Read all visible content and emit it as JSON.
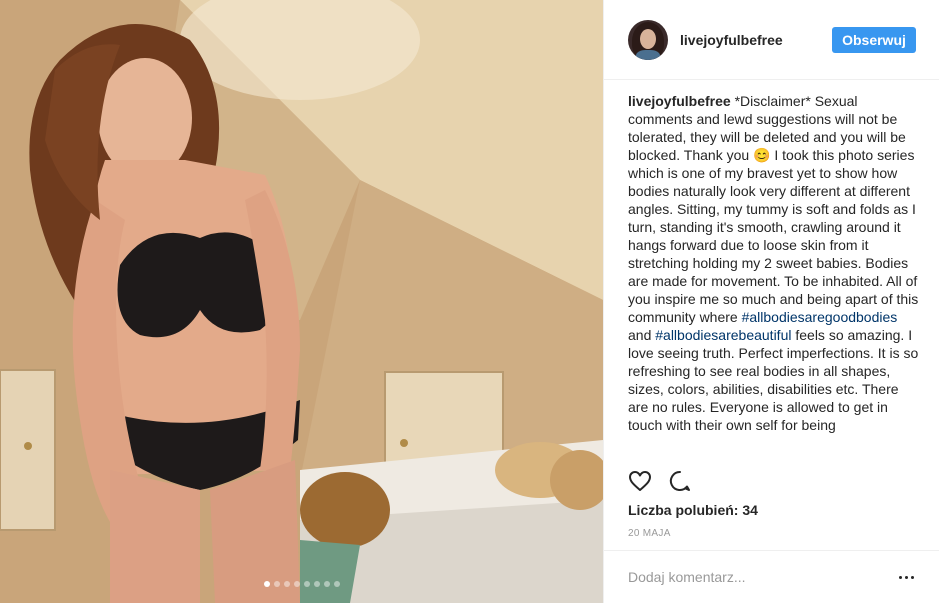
{
  "header": {
    "username": "livejoyfulbefree",
    "follow_label": "Obserwuj"
  },
  "caption": {
    "username": "livejoyfulbefree",
    "text_part1": " *Disclaimer* Sexual comments and lewd suggestions will not be tolerated, they will be deleted and you will be blocked. Thank you ",
    "emoji": "😊",
    "text_part2": " I took this photo series which is one of my bravest yet to show how bodies naturally look very different at different angles. Sitting, my tummy is soft and folds as I turn, standing it's smooth, crawling around it hangs forward due to loose skin from it stretching holding my 2 sweet babies. Bodies are made for movement. To be inhabited. All of you inspire me so much and being apart of this community where ",
    "hashtag1": "#allbodiesaregoodbodies",
    "text_part3": " and ",
    "hashtag2": "#allbodiesarebeautiful",
    "text_part4": " feels so amazing. I love seeing truth. Perfect imperfections. It is so refreshing to see real bodies in all shapes, sizes, colors, abilities, disabilities etc. There are no rules. Everyone is allowed to get in touch with their own self for being"
  },
  "actions": {
    "like_icon": "heart-icon",
    "comment_icon": "comment-icon"
  },
  "likes_text": "Liczba polubień: 34",
  "date_text": "20 MAJA",
  "comment": {
    "placeholder": "Dodaj komentarz...",
    "more_icon": "more-options-icon"
  },
  "carousel": {
    "slide_count": 8,
    "active_index": 0
  },
  "colors": {
    "follow_button": "#3897f0",
    "hashtag": "#003569",
    "muted_text": "#999999"
  }
}
